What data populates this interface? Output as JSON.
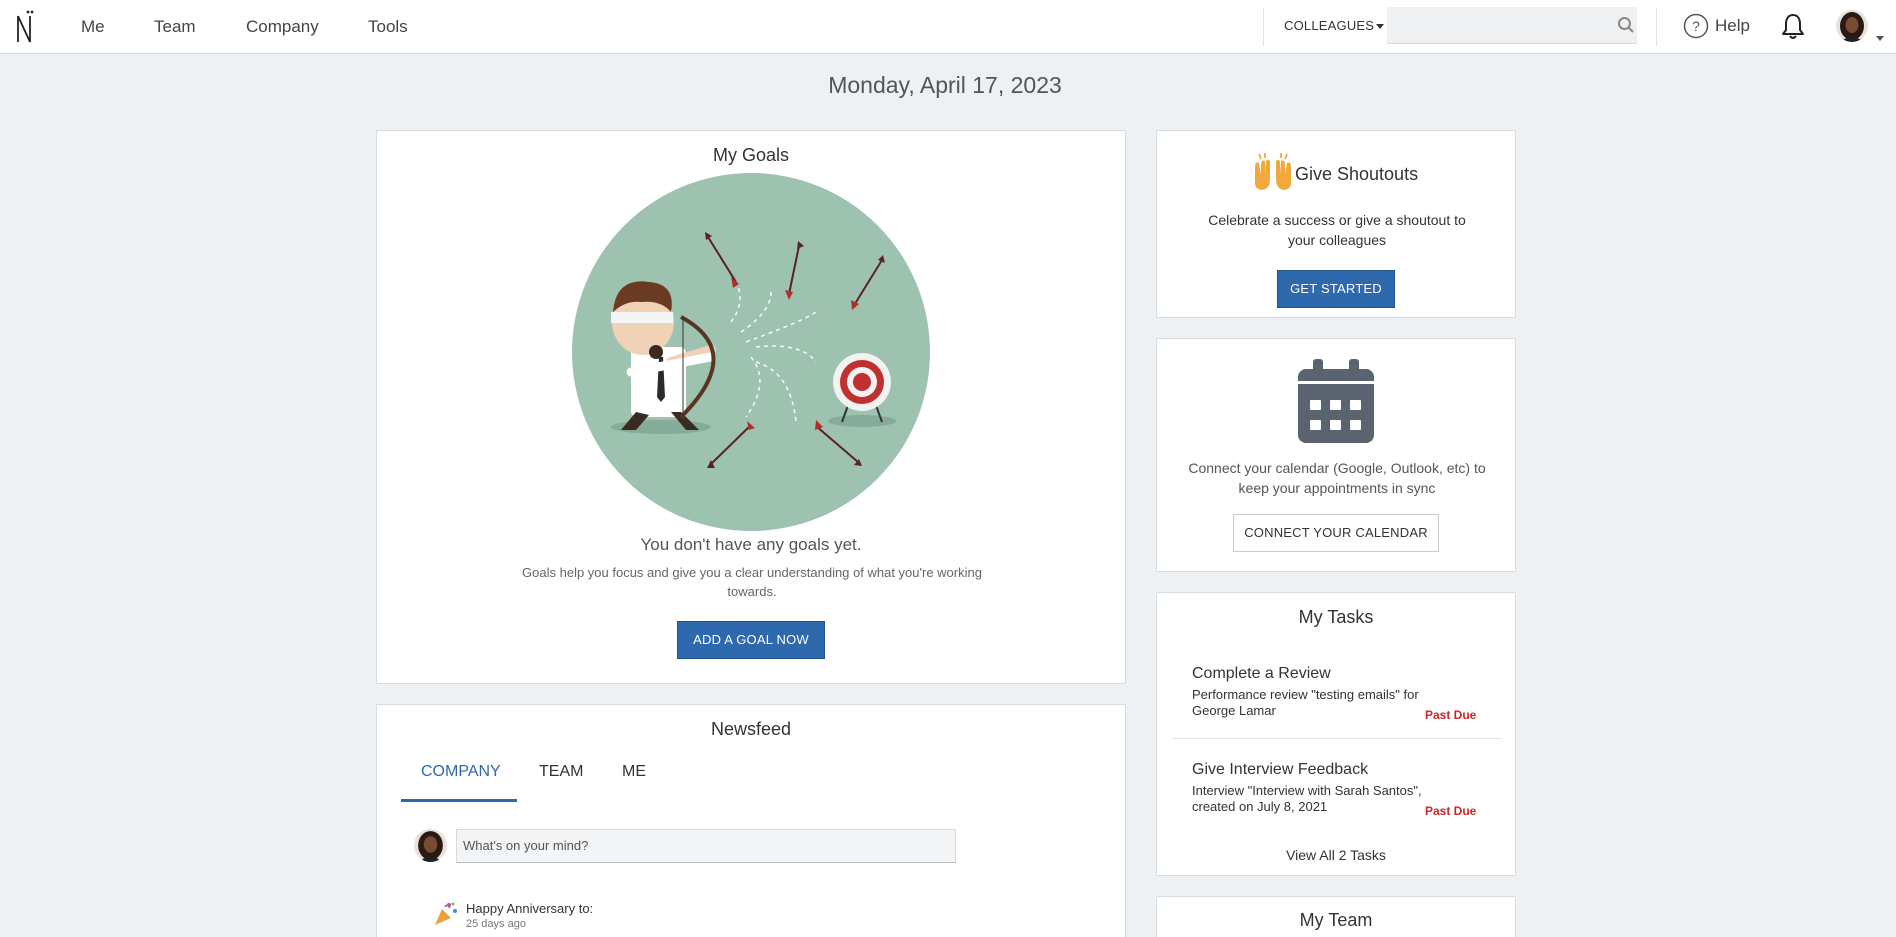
{
  "nav": {
    "items": [
      "Me",
      "Team",
      "Company",
      "Tools"
    ],
    "colleagues_label": "COLLEAGUES",
    "search_value": "",
    "help_label": "Help"
  },
  "date": "Monday, April 17, 2023",
  "goals": {
    "title": "My Goals",
    "empty_heading": "You don't have any goals yet.",
    "empty_text": "Goals help you focus and give you a clear understanding of what you're working towards.",
    "button": "ADD A GOAL NOW"
  },
  "newsfeed": {
    "title": "Newsfeed",
    "tabs": [
      "COMPANY",
      "TEAM",
      "ME"
    ],
    "active_tab": "COMPANY",
    "input_placeholder": "What's on your mind?",
    "post": {
      "title": "Happy Anniversary to:",
      "time": "25 days ago"
    }
  },
  "shoutouts": {
    "title": "Give Shoutouts",
    "text": "Celebrate a success or give a shoutout to your colleagues",
    "button": "GET STARTED"
  },
  "calendar": {
    "text": "Connect your calendar (Google, Outlook, etc) to keep your appointments in sync",
    "button": "CONNECT YOUR CALENDAR"
  },
  "tasks": {
    "title": "My Tasks",
    "items": [
      {
        "title": "Complete a Review",
        "desc": "Performance review \"testing emails\" for George Lamar",
        "status": "Past Due"
      },
      {
        "title": "Give Interview Feedback",
        "desc": "Interview \"Interview with Sarah Santos\", created on July 8, 2021",
        "status": "Past Due"
      }
    ],
    "view_all": "View All 2 Tasks"
  },
  "team": {
    "title": "My Team"
  },
  "colors": {
    "primary": "#2e69ae",
    "past_due": "#c62828",
    "goal_circle": "#9dc2b0",
    "background": "#edf1f4"
  }
}
